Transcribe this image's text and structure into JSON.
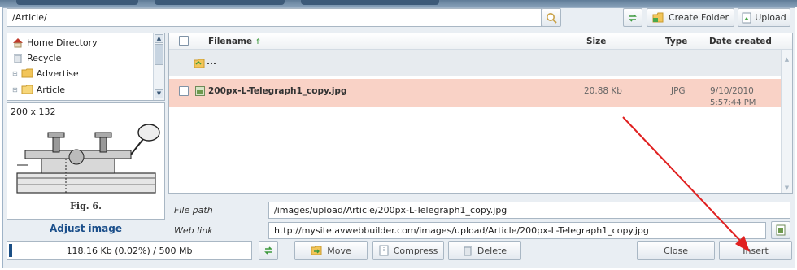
{
  "toolbar": {
    "path_value": "/Article/",
    "create_folder_label": "Create Folder",
    "upload_label": "Upload"
  },
  "sidebar": {
    "items": [
      {
        "label": "Home Directory"
      },
      {
        "label": "Recycle"
      },
      {
        "label": "Advertise"
      },
      {
        "label": "Article"
      }
    ]
  },
  "preview": {
    "dimensions": "200 x 132",
    "caption": "Fig. 6.",
    "adjust_label": "Adjust image"
  },
  "filelist": {
    "headers": {
      "filename": "Filename",
      "size": "Size",
      "type": "Type",
      "date": "Date created"
    },
    "parent_label": "...",
    "rows": [
      {
        "name": "200px-L-Telegraph1_copy.jpg",
        "size": "20.88 Kb",
        "type": "JPG",
        "date": "9/10/2010",
        "time": "5:57:44 PM"
      }
    ]
  },
  "details": {
    "file_path_label": "File path",
    "file_path_value": "/images/upload/Article/200px-L-Telegraph1_copy.jpg",
    "web_link_label": "Web link",
    "web_link_value": "http://mysite.avwebbuilder.com/images/upload/Article/200px-L-Telegraph1_copy.jpg"
  },
  "bottom": {
    "storage_text": "118.16 Kb (0.02%) / 500 Mb",
    "storage_fraction": 0.0002,
    "move_label": "Move",
    "compress_label": "Compress",
    "delete_label": "Delete",
    "close_label": "Close",
    "insert_label": "Insert"
  },
  "colors": {
    "selected_row": "#f9d2c6",
    "tree_selected": "#3a7bd5",
    "annotation_arrow": "#e02020"
  }
}
